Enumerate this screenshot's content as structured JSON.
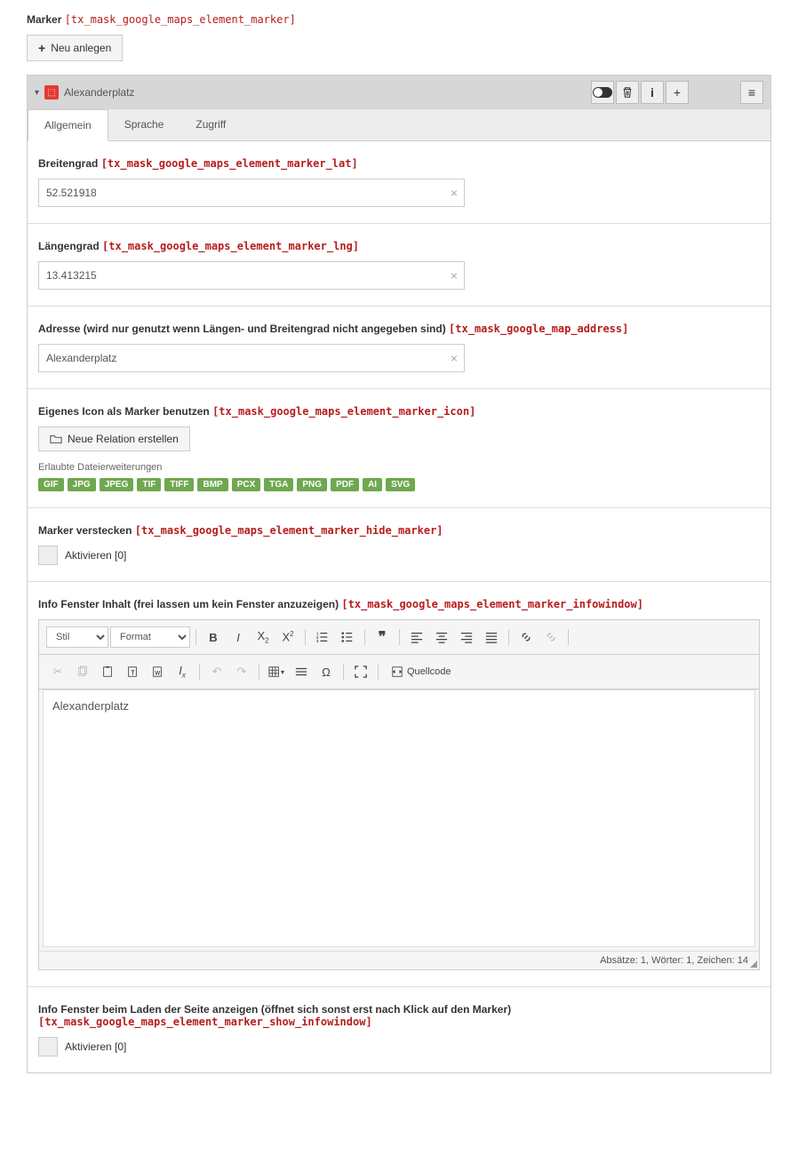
{
  "header": {
    "label": "Marker",
    "tech": "[tx_mask_google_maps_element_marker]",
    "new_button": "Neu anlegen"
  },
  "panel": {
    "title": "Alexanderplatz",
    "tabs": {
      "general": "Allgemein",
      "language": "Sprache",
      "access": "Zugriff"
    }
  },
  "fields": {
    "lat": {
      "label": "Breitengrad",
      "tech": "[tx_mask_google_maps_element_marker_lat]",
      "value": "52.521918"
    },
    "lng": {
      "label": "Längengrad",
      "tech": "[tx_mask_google_maps_element_marker_lng]",
      "value": "13.413215"
    },
    "address": {
      "label": "Adresse (wird nur genutzt wenn Längen- und Breitengrad nicht angegeben sind)",
      "tech": "[tx_mask_google_map_address]",
      "value": "Alexanderplatz"
    },
    "icon": {
      "label": "Eigenes Icon als Marker benutzen",
      "tech": "[tx_mask_google_maps_element_marker_icon]",
      "button": "Neue Relation erstellen",
      "ext_label": "Erlaubte Dateierweiterungen"
    },
    "hide": {
      "label": "Marker verstecken",
      "tech": "[tx_mask_google_maps_element_marker_hide_marker]",
      "check": "Aktivieren [0]"
    },
    "infowindow": {
      "label": "Info Fenster Inhalt (frei lassen um kein Fenster anzuzeigen)",
      "tech": "[tx_mask_google_maps_element_marker_infowindow]",
      "content": "Alexanderplatz",
      "status": "Absätze: 1, Wörter: 1, Zeichen: 14"
    },
    "showinfo": {
      "label": "Info Fenster beim Laden der Seite anzeigen (öffnet sich sonst erst nach Klick auf den Marker)",
      "tech": "[tx_mask_google_maps_element_marker_show_infowindow]",
      "check": "Aktivieren [0]"
    }
  },
  "extensions": [
    "GIF",
    "JPG",
    "JPEG",
    "TIF",
    "TIFF",
    "BMP",
    "PCX",
    "TGA",
    "PNG",
    "PDF",
    "AI",
    "SVG"
  ],
  "rte": {
    "style_label": "Stil",
    "format_label": "Format",
    "source_label": "Quellcode"
  }
}
